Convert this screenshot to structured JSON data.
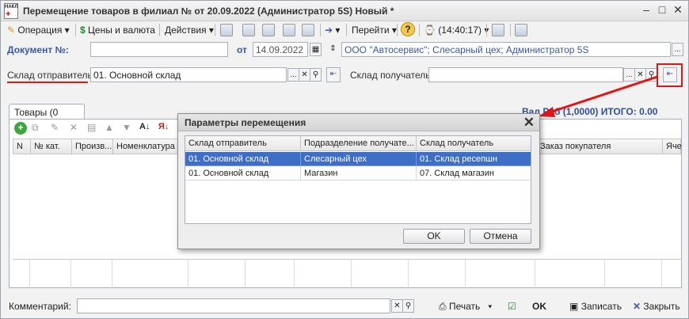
{
  "window": {
    "app_icon_label": "НАКЛ",
    "title": "Перемещение товаров в филиал №  от 20.09.2022 (Администратор 5S) Новый *"
  },
  "toolbar": {
    "operation": "Операция",
    "prices": "Цены и валюта",
    "actions": "Действия",
    "goto": "Перейти",
    "time": "(14:40:17)"
  },
  "header": {
    "doc_label": "Документ №:",
    "doc_value": "",
    "from_label": "от",
    "date": "14.09.2022",
    "org": "ООО \"Автосервис\"; Слесарный цех; Администратор 5S"
  },
  "warehouses": {
    "sender_label": "Склад отправитель:",
    "sender_value": "01.  Основной склад",
    "receiver_label": "Склад получатель:",
    "receiver_value": ""
  },
  "tabs": [
    {
      "label": "Товары (0 поз.)"
    }
  ],
  "totals": {
    "text": "Руб (1,0000) ИТОГО: 0.00",
    "currency_prefix": "Вал"
  },
  "goods_grid": {
    "columns": [
      "N",
      "№ кат.",
      "Произв...",
      "Номенклатура",
      "Заказ покупателя",
      "Яче"
    ]
  },
  "bottom": {
    "comment_label": "Комментарий:",
    "comment_value": "",
    "print": "Печать",
    "ok": "OK",
    "save": "Записать",
    "close": "Закрыть"
  },
  "dialog": {
    "title": "Параметры перемещения",
    "columns": [
      "Склад отправитель",
      "Подразделение получате...",
      "Склад получатель"
    ],
    "rows": [
      [
        "01.  Основной склад",
        "Слесарный цех",
        "01. Склад ресепшн"
      ],
      [
        "01.  Основной склад",
        "Магазин",
        "07. Склад магазин"
      ]
    ],
    "selected_row": 0,
    "ok": "OK",
    "cancel": "Отмена"
  },
  "colors": {
    "selection": "#3f6ec6",
    "annotation": "#e01616",
    "link": "#3a58a8"
  }
}
